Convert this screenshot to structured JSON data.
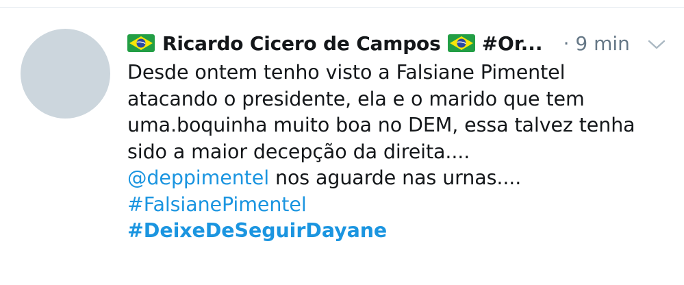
{
  "tweet": {
    "author_name": "Ricardo Cicero de Campos",
    "handle_truncated": "#Or...",
    "time_sep": "·",
    "time": "9 min",
    "flag_emoji": "brazil-flag",
    "lines": [
      "Desde ontem tenho visto a Falsiane Pimentel",
      "atacando o presidente, ela e o marido que tem",
      "uma.boquinha muito boa no DEM, essa talvez tenha",
      "sido a maior decepção da direita...."
    ],
    "mention": "@deppimentel",
    "mention_rest": " nos aguarde nas urnas....",
    "hashtag1": "#FalsianePimentel",
    "hashtag2": "#DeixeDeSeguirDayane"
  },
  "colors": {
    "link": "#1b95e0",
    "text": "#14171a",
    "muted": "#657786",
    "avatar_placeholder": "#ccd6dd"
  }
}
